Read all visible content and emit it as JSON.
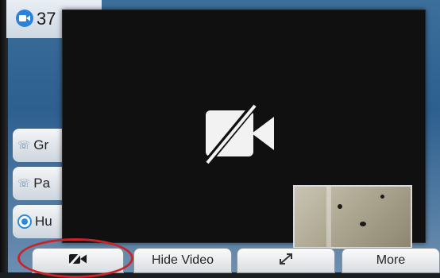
{
  "header": {
    "partial_text": "37"
  },
  "left_list": {
    "items": [
      {
        "label": "Gr",
        "kind": "phone"
      },
      {
        "label": "Pa",
        "kind": "phone"
      },
      {
        "label": "Hu",
        "kind": "radio"
      }
    ]
  },
  "video": {
    "state_icon": "camera-off-icon",
    "self_view": "self-view-thumbnail"
  },
  "controls": {
    "camera_toggle_icon": "camera-off-icon",
    "hide_video_label": "Hide Video",
    "expand_icon": "expand-arrows-icon",
    "more_label": "More"
  },
  "colors": {
    "accent_blue": "#2c82d9",
    "highlight_red": "#c8252b",
    "video_bg": "#101010"
  }
}
